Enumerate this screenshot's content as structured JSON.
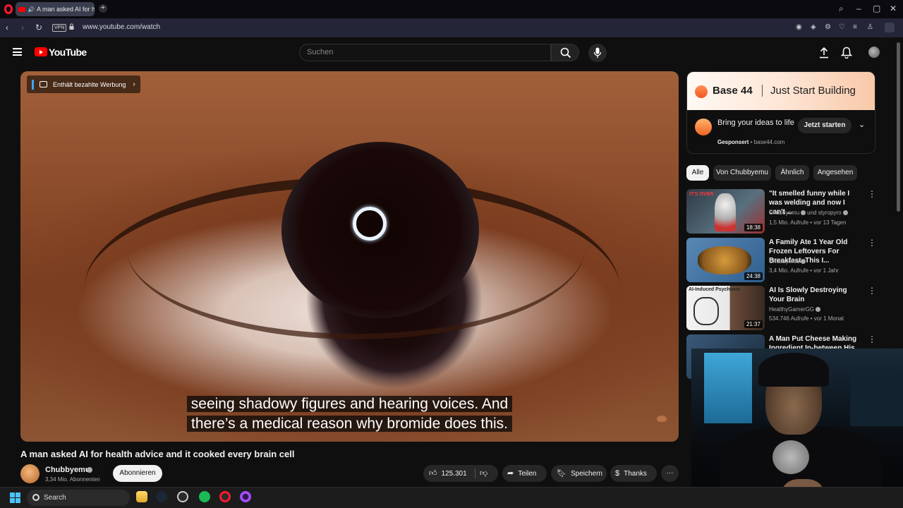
{
  "browser": {
    "tab_title": "A man asked AI for he",
    "url": "www.youtube.com/watch",
    "vpn_label": "VPN"
  },
  "header": {
    "logo_text": "YouTube",
    "search_placeholder": "Suchen"
  },
  "player": {
    "ad_badge": "Enthält bezahlte Werbung",
    "caption_line1": "seeing shadowy figures and hearing voices. And",
    "caption_line2": "there’s a medical reason why bromide does this."
  },
  "video": {
    "title": "A man asked AI for health advice and it cooked every brain cell",
    "channel": "Chubbyemu",
    "subscribers": "3,34 Mio. Abonnenten",
    "subscribe_label": "Abonnieren",
    "likes": "125.301",
    "share_label": "Teilen",
    "save_label": "Speichern",
    "thanks_label": "Thanks"
  },
  "ad_card": {
    "brand": "Base 44",
    "tagline": "Just Start Building",
    "headline": "Bring your ideas to life",
    "sponsored": "Gesponsert",
    "domain": "base44.com",
    "cta": "Jetzt starten",
    "brand_color": "#f0561f"
  },
  "chips": [
    "Alle",
    "Von Chubbyemu",
    "Ähnlich",
    "Angesehen"
  ],
  "recommendations": [
    {
      "title": "\"It smelled funny while I was welding and now I can't ...",
      "channel": "Chubbyemu",
      "collab": "und styropyro",
      "meta": "1,5 Mio. Aufrufe • vor 13 Tagen",
      "duration": "18:38",
      "thumb_text": "IT'S OVER"
    },
    {
      "title": "A Family Ate 1 Year Old Frozen Leftovers For Breakfast. This I...",
      "channel": "Chubbyemu",
      "meta": "3,4 Mio. Aufrufe • vor 1 Jahr",
      "duration": "24:38"
    },
    {
      "title": "AI Is Slowly Destroying Your Brain",
      "channel": "HealthyGamerGG",
      "meta": "534.746 Aufrufe • vor 1 Monat",
      "duration": "21:37",
      "thumb_text": "AI-Induced Psychosis"
    },
    {
      "title": "A Man Put Cheese Making Ingredient In-between His Leg..."
    }
  ],
  "taskbar": {
    "search_label": "Search"
  }
}
